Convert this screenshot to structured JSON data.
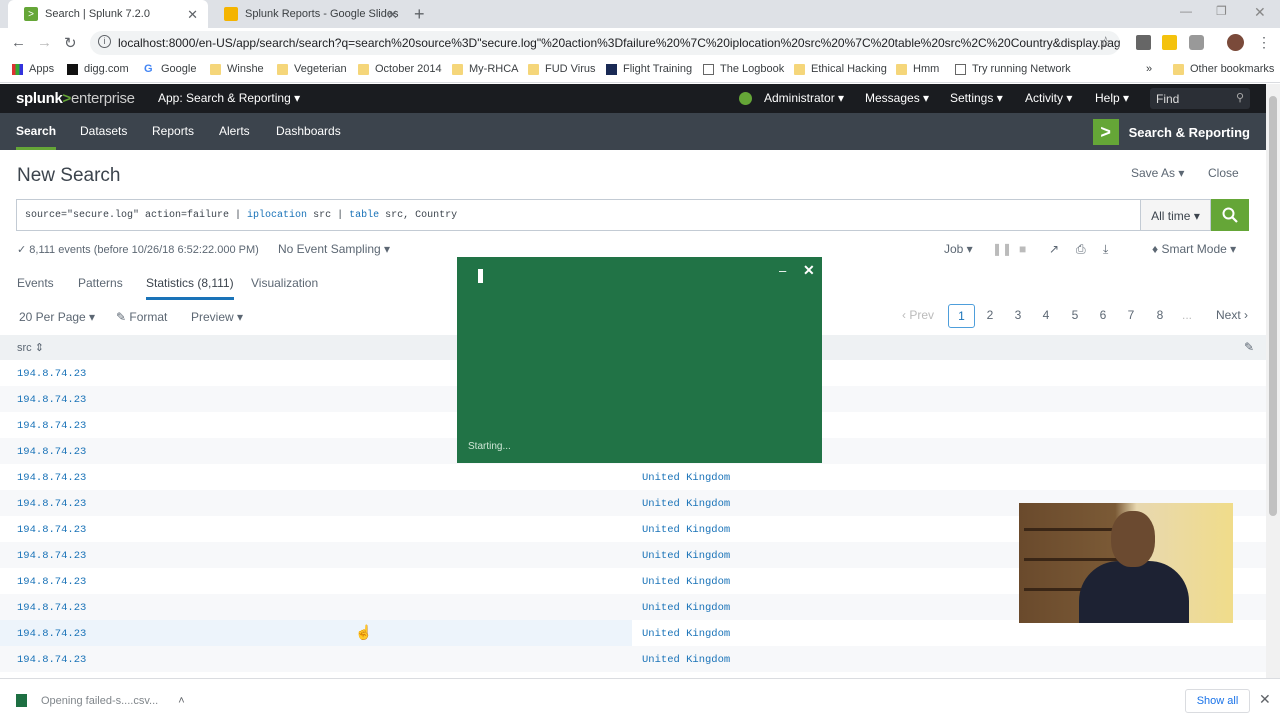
{
  "browser": {
    "tabs": [
      {
        "title": "Search | Splunk 7.2.0",
        "active": true
      },
      {
        "title": "Splunk Reports - Google Slides",
        "active": false
      }
    ],
    "url": "localhost:8000/en-US/app/search/search?q=search%20source%3D\"secure.log\"%20action%3Dfailure%20%7C%20iplocation%20src%20%7C%20table%20src%2C%20Country&display.page....",
    "bookmarks": [
      "Apps",
      "digg.com",
      "Google",
      "Winshe",
      "Vegeterian",
      "October 2014",
      "My-RHCA",
      "FUD Virus",
      "Flight Training",
      "The Logbook",
      "Ethical Hacking",
      "Hmm",
      "Try running Network"
    ],
    "other_bookmarks": "Other bookmarks"
  },
  "splunk": {
    "logo_main": "splunk",
    "logo_gt": ">",
    "logo_ent": "enterprise",
    "app_menu": "App: Search & Reporting ▾",
    "admin": "Administrator ▾",
    "messages": "Messages ▾",
    "settings": "Settings ▾",
    "activity": "Activity ▾",
    "help": "Help ▾",
    "find_placeholder": "Find",
    "nav": [
      "Search",
      "Datasets",
      "Reports",
      "Alerts",
      "Dashboards"
    ],
    "app_title": "Search & Reporting"
  },
  "search": {
    "page_title": "New Search",
    "save_as": "Save As ▾",
    "close": "Close",
    "query_parts": [
      "source=\"secure.log\" action=failure | ",
      "iplocation",
      " src | ",
      "table",
      " src, Country"
    ],
    "time_range": "All time ▾",
    "events_status": "✓ 8,111 events (before 10/26/18 6:52:22.000 PM)",
    "sampling": "No Event Sampling ▾",
    "job": "Job ▾",
    "mode": "Smart Mode ▾"
  },
  "result_tabs": [
    "Events",
    "Patterns",
    "Statistics (8,111)",
    "Visualization"
  ],
  "toolbar": {
    "per_page": "20 Per Page ▾",
    "format": "Format",
    "preview": "Preview ▾"
  },
  "pagination": {
    "prev": "‹ Prev",
    "pages": [
      "1",
      "2",
      "3",
      "4",
      "5",
      "6",
      "7",
      "8",
      "..."
    ],
    "next": "Next ›"
  },
  "table": {
    "column_src": "src ⇕",
    "rows": [
      {
        "src": "194.8.74.23",
        "country": ""
      },
      {
        "src": "194.8.74.23",
        "country": ""
      },
      {
        "src": "194.8.74.23",
        "country": ""
      },
      {
        "src": "194.8.74.23",
        "country": ""
      },
      {
        "src": "194.8.74.23",
        "country": "United Kingdom"
      },
      {
        "src": "194.8.74.23",
        "country": "United Kingdom"
      },
      {
        "src": "194.8.74.23",
        "country": "United Kingdom"
      },
      {
        "src": "194.8.74.23",
        "country": "United Kingdom"
      },
      {
        "src": "194.8.74.23",
        "country": "United Kingdom"
      },
      {
        "src": "194.8.74.23",
        "country": "United Kingdom"
      },
      {
        "src": "194.8.74.23",
        "country": "United Kingdom"
      },
      {
        "src": "194.8.74.23",
        "country": "United Kingdom"
      }
    ]
  },
  "dialog": {
    "status": "Starting..."
  },
  "download": {
    "file": "Opening failed-s....csv...",
    "show_all": "Show all"
  }
}
